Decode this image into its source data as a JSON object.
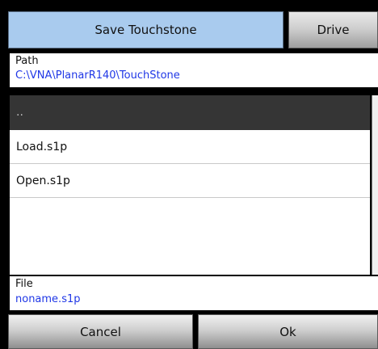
{
  "header": {
    "title": "Save Touchstone",
    "drive_label": "Drive"
  },
  "path": {
    "label": "Path",
    "value": "C:\\VNA\\PlanarR140\\TouchStone"
  },
  "list": {
    "items": [
      {
        "label": "..",
        "selected": true
      },
      {
        "label": "Load.s1p",
        "selected": false
      },
      {
        "label": "Open.s1p",
        "selected": false
      }
    ]
  },
  "file": {
    "label": "File",
    "value": "noname.s1p"
  },
  "buttons": {
    "cancel_label": "Cancel",
    "ok_label": "Ok"
  },
  "colors": {
    "title_bg": "#a9cbee",
    "path_text": "#1f37e6",
    "selected_row_bg": "#353535"
  }
}
